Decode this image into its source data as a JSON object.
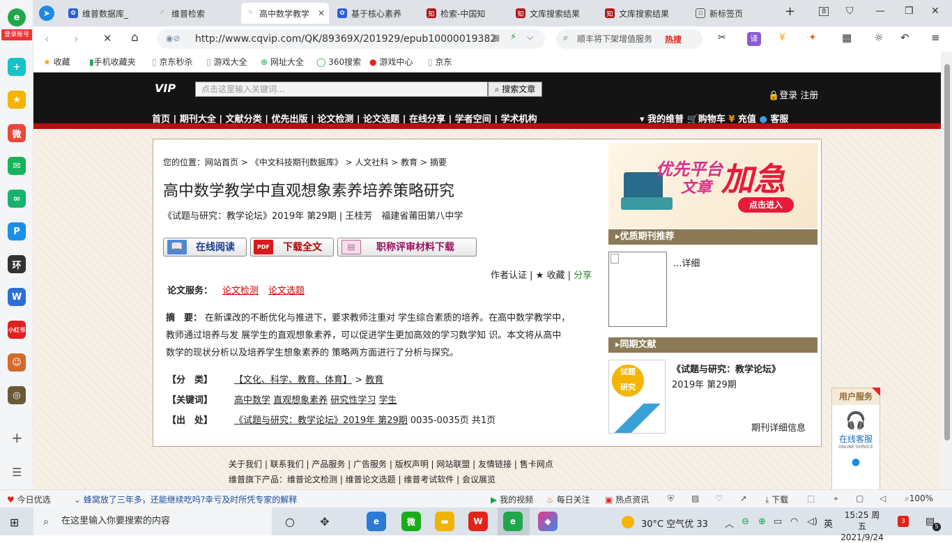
{
  "browser": {
    "login_label": "登录账号",
    "tabs": [
      {
        "label": "维普数据库_",
        "icon": "paw-icon"
      },
      {
        "label": "维普检索",
        "icon": "loading-icon"
      },
      {
        "label": "高中数学教学",
        "icon": "loading-icon"
      },
      {
        "label": "基于核心素养",
        "icon": "paw-icon"
      },
      {
        "label": "检索-中国知",
        "icon": "cnki-icon"
      },
      {
        "label": "文库搜索结果",
        "icon": "cnki-icon"
      },
      {
        "label": "文库搜索结果",
        "icon": "cnki-icon"
      },
      {
        "label": "新标签页",
        "icon": "newtab-icon"
      }
    ],
    "tab_count": "8",
    "url": "http://www.cqvip.com/QK/89369X/201929/epub10000019382",
    "search_placeholder": "顺丰将下架增值服务",
    "hot_label": "热搜",
    "ext_label": "译",
    "bookmarks": [
      "收藏",
      "手机收藏夹",
      "京东秒杀",
      "游戏大全",
      "网址大全",
      "360搜索",
      "游戏中心",
      "京东"
    ]
  },
  "site": {
    "logo_text": "VIP",
    "search_placeholder": "点击这里输入关键词...",
    "search_button": "搜索文章",
    "login": "登录",
    "register": "注册",
    "nav": [
      "首页",
      "期刊大全",
      "文献分类",
      "优先出版",
      "论文检测",
      "论文选题",
      "在线分享",
      "学者空间",
      "学术机构"
    ],
    "user_links": [
      "我的维普",
      "购物车",
      "充值",
      "客服"
    ]
  },
  "article": {
    "breadcrumb": [
      "您的位置：网站首页",
      "《中文科技期刊数据库》",
      "人文社科",
      "教育",
      "摘要"
    ],
    "title": "高中数学教学中直观想象素养培养策略研究",
    "source": "《试题与研究：教学论坛》2019年 第29期 | 王桂芳　福建省莆田第八中学",
    "btn_read": "在线阅读",
    "btn_download": "下载全文",
    "btn_material": "职称评审材料下载",
    "btn_pdf_tag": "PDF",
    "author_cert": "作者认证",
    "favorite": "收藏",
    "share": "分享",
    "service_label": "论文服务：",
    "service_links": [
      "论文检测",
      "论文选题"
    ],
    "abstract_label": "摘　要：",
    "abstract_lines": [
      "在新课改的不断优化与推进下，要求教师注重对 学生综合素质的培养。在高中数学教学中，",
      "教师通过培养与发 展学生的直观想象素养，可以促进学生更加高效的学习数学知 识。本文将从高中",
      "数学的现状分析以及培养学生想象素养的 策略两方面进行了分析与探究。"
    ],
    "class_label": "【分　类】",
    "class_value": "【文化、科学、教育、体育】",
    "class_sep": ">",
    "class_sub": "教育",
    "keyword_label": "【关键词】",
    "keywords": [
      "高中数学",
      "直观想象素养",
      "研究性学习",
      "学生"
    ],
    "source_label": "【出　处】",
    "source_link": "《试题与研究：教学论坛》2019年 第29期",
    "source_pages": "0035-0035页 共1页"
  },
  "sidebar": {
    "ad_line1": "优先平台",
    "ad_line2": "文章",
    "ad_big": "加急",
    "ad_btn": "点击进入",
    "section1": "优质期刊推荐",
    "detail": "...详细",
    "section2": "同期文献",
    "journal_name": "《试题与研究：教学论坛》",
    "journal_issue": "2019年 第29期",
    "cover_text1": "试",
    "cover_text2": "题",
    "cover_text3": "研",
    "cover_text4": "究",
    "journal_info": "期刊详细信息"
  },
  "service_widget": {
    "title": "用户服务",
    "online": "在线客服",
    "online_en": "ONLINE SERVICE"
  },
  "footer": {
    "line1": "关于我们 | 联系我们 | 产品服务 | 广告服务 | 版权声明 | 网站联盟 | 友情链接 | 售卡网点",
    "line2": "维普旗下产品：维普论文检测 | 维普论文选题 | 维普考试软件 | 会议展览"
  },
  "statusbar": {
    "today": "今日优选",
    "news": "蜂窝放了三年多，还能继续吃吗?幸亏及时所凭专家的解释",
    "video": "我的视频",
    "daily": "每日关注",
    "hot": "热点资讯",
    "download": "下载",
    "zoom": "100%"
  },
  "taskbar": {
    "search_placeholder": "在这里输入你要搜索的内容",
    "weather": "30°C  空气优 33",
    "ime": "英",
    "time": "15:25 周五",
    "date": "2021/9/24",
    "notif_count": "3",
    "msg_count": "5"
  },
  "colors": {
    "accent_red": "#d20000",
    "header_black": "#141414",
    "side_header": "#8c7a56"
  }
}
